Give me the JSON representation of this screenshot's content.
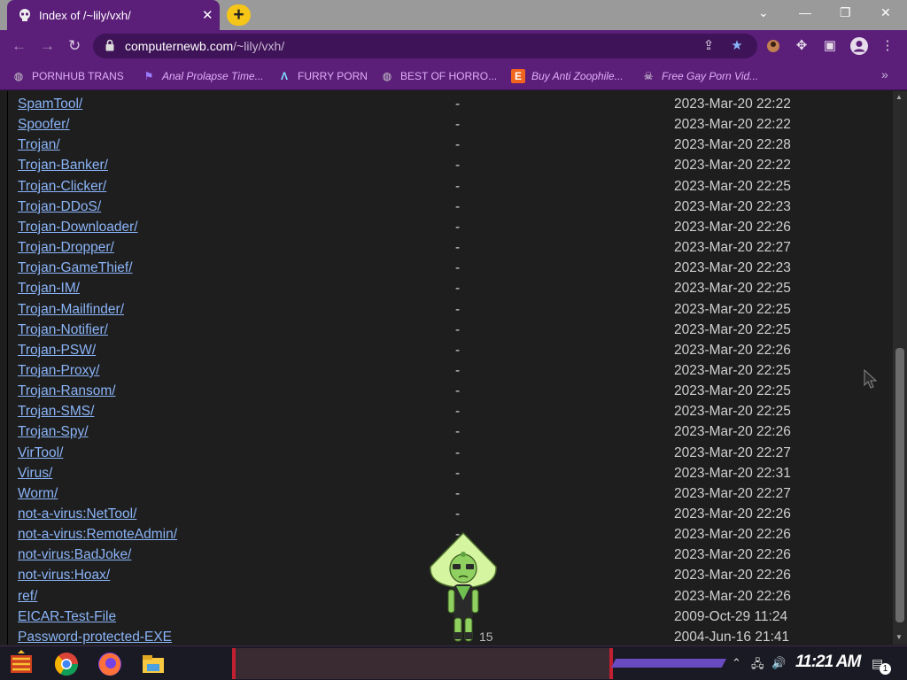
{
  "tab": {
    "title": "Index of /~lily/vxh/",
    "close": "✕"
  },
  "newtab": {
    "label": "+"
  },
  "window_controls": {
    "dropdown": "⌄",
    "minimize": "—",
    "restore": "❐",
    "close": "✕"
  },
  "toolbar": {
    "back": "←",
    "forward": "→",
    "reload": "↻",
    "url_host": "computernewb.com",
    "url_path": "/~lily/vxh/",
    "menu": "⋮"
  },
  "bookmarks": [
    {
      "label": "PORNHUB TRANS",
      "icon": "globe-icon"
    },
    {
      "label": "Anal Prolapse Time...",
      "icon": "flag-icon"
    },
    {
      "label": "FURRY PORN",
      "icon": "a-logo-icon"
    },
    {
      "label": "BEST OF HORRO...",
      "icon": "globe-icon"
    },
    {
      "label": "Buy Anti Zoophile...",
      "icon": "etsy-icon"
    },
    {
      "label": "Free Gay Porn Vid...",
      "icon": "skull-icon"
    }
  ],
  "bookmarks_more": "»",
  "listing": [
    {
      "name": "SpamTool/",
      "size": "-",
      "date": "2023-Mar-20 22:22"
    },
    {
      "name": "Spoofer/",
      "size": "-",
      "date": "2023-Mar-20 22:22"
    },
    {
      "name": "Trojan/",
      "size": "-",
      "date": "2023-Mar-20 22:28"
    },
    {
      "name": "Trojan-Banker/",
      "size": "-",
      "date": "2023-Mar-20 22:22"
    },
    {
      "name": "Trojan-Clicker/",
      "size": "-",
      "date": "2023-Mar-20 22:25"
    },
    {
      "name": "Trojan-DDoS/",
      "size": "-",
      "date": "2023-Mar-20 22:23"
    },
    {
      "name": "Trojan-Downloader/",
      "size": "-",
      "date": "2023-Mar-20 22:26"
    },
    {
      "name": "Trojan-Dropper/",
      "size": "-",
      "date": "2023-Mar-20 22:27"
    },
    {
      "name": "Trojan-GameThief/",
      "size": "-",
      "date": "2023-Mar-20 22:23"
    },
    {
      "name": "Trojan-IM/",
      "size": "-",
      "date": "2023-Mar-20 22:25"
    },
    {
      "name": "Trojan-Mailfinder/",
      "size": "-",
      "date": "2023-Mar-20 22:25"
    },
    {
      "name": "Trojan-Notifier/",
      "size": "-",
      "date": "2023-Mar-20 22:25"
    },
    {
      "name": "Trojan-PSW/",
      "size": "-",
      "date": "2023-Mar-20 22:26"
    },
    {
      "name": "Trojan-Proxy/",
      "size": "-",
      "date": "2023-Mar-20 22:25"
    },
    {
      "name": "Trojan-Ransom/",
      "size": "-",
      "date": "2023-Mar-20 22:25"
    },
    {
      "name": "Trojan-SMS/",
      "size": "-",
      "date": "2023-Mar-20 22:25"
    },
    {
      "name": "Trojan-Spy/",
      "size": "-",
      "date": "2023-Mar-20 22:26"
    },
    {
      "name": "VirTool/",
      "size": "-",
      "date": "2023-Mar-20 22:27"
    },
    {
      "name": "Virus/",
      "size": "-",
      "date": "2023-Mar-20 22:31"
    },
    {
      "name": "Worm/",
      "size": "-",
      "date": "2023-Mar-20 22:27"
    },
    {
      "name": "not-a-virus:NetTool/",
      "size": "-",
      "date": "2023-Mar-20 22:26"
    },
    {
      "name": "not-a-virus:RemoteAdmin/",
      "size": "-",
      "date": "2023-Mar-20 22:26"
    },
    {
      "name": "not-virus:BadJoke/",
      "size": "-",
      "date": "2023-Mar-20 22:26"
    },
    {
      "name": "not-virus:Hoax/",
      "size": "-",
      "date": "2023-Mar-20 22:26"
    },
    {
      "name": "ref/",
      "size": "-",
      "date": "2023-Mar-20 22:26"
    },
    {
      "name": "EICAR-Test-File",
      "size": "",
      "date": "2009-Oct-29 11:24"
    },
    {
      "name": "Password-protected-EXE",
      "size": "",
      "date": "2004-Jun-16 21:41"
    }
  ],
  "mascot": {
    "number": "15"
  },
  "taskbar": {
    "clock": "11:21 AM",
    "notification_count": "1"
  },
  "colors": {
    "chrome_purple": "#5b1f7a",
    "link": "#8ab4f8",
    "page_bg": "#1e1e1e",
    "bookmark_text": "#e0aef9"
  }
}
